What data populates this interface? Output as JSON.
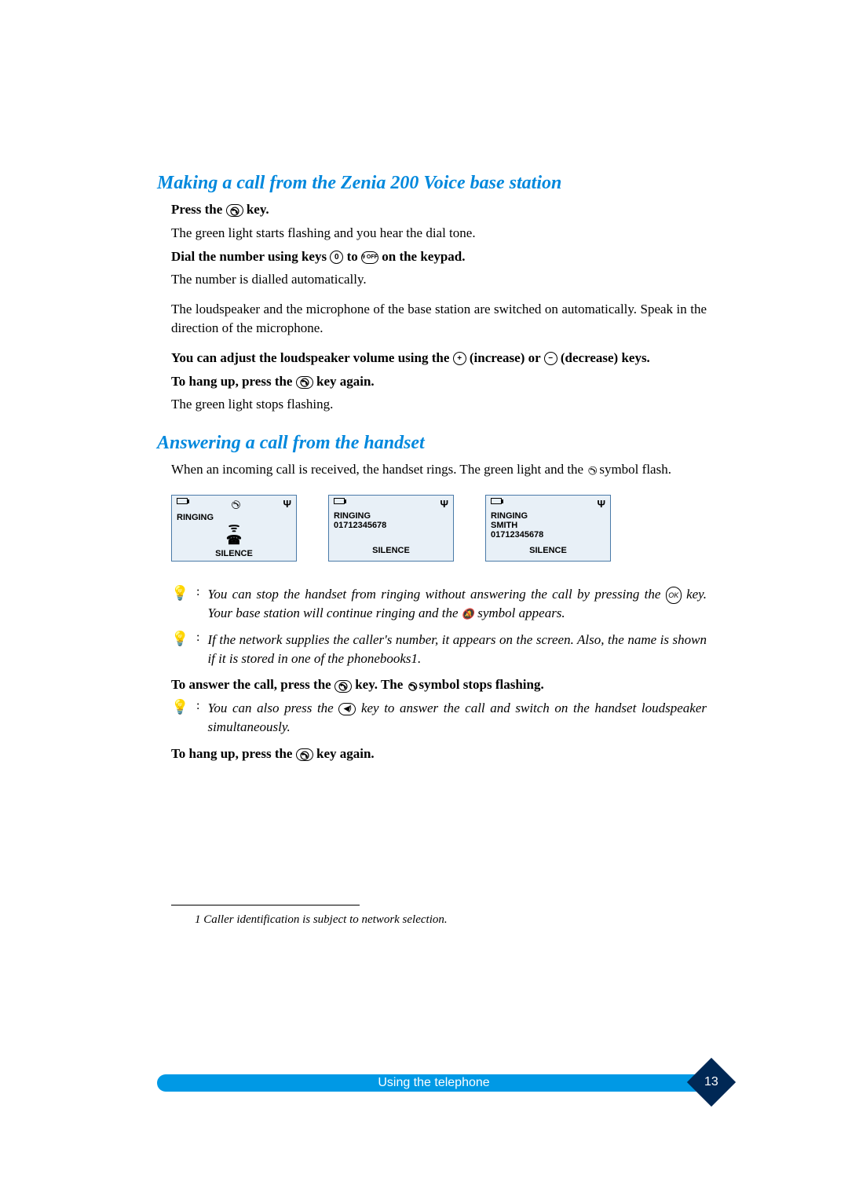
{
  "section1": {
    "heading": "Making a call from the Zenia 200 Voice base station",
    "press_the": "Press the ",
    "key_word": " key.",
    "green_flash": "The green light starts flashing and you hear the dial tone.",
    "dial_prefix": "Dial the number using keys ",
    "dial_to": " to ",
    "dial_suffix": " on the keypad.",
    "auto_dial": "The number is dialled automatically.",
    "loudspeaker": "The loudspeaker and the microphone of the base station are switched on automatically. Speak in the direction of the microphone.",
    "adjust_prefix": "You can adjust the loudspeaker volume using the ",
    "increase": " (increase) or ",
    "decrease": " (decrease) keys.",
    "hangup_prefix": "To hang up, press the ",
    "hangup_suffix": " key again.",
    "green_stop": "The green light stops flashing."
  },
  "section2": {
    "heading": "Answering a call from the handset",
    "intro_prefix": "When an incoming call is received, the handset rings. The green light and the ",
    "intro_suffix": " symbol flash.",
    "screens": [
      {
        "lines": [
          "RINGING"
        ],
        "footer": "SILENCE",
        "show_phone_center": true,
        "show_handset_top": true
      },
      {
        "lines": [
          "RINGING",
          "01712345678"
        ],
        "footer": "SILENCE",
        "show_phone_center": false,
        "show_handset_top": false
      },
      {
        "lines": [
          "RINGING",
          "SMITH",
          "01712345678"
        ],
        "footer": "SILENCE",
        "show_phone_center": false,
        "show_handset_top": false
      }
    ],
    "tip1_a": "You can stop the handset from ringing without answering the call by pressing the ",
    "tip1_b": " key. Your base station will continue ringing and the ",
    "tip1_c": " symbol appears.",
    "tip2": "If the network supplies the caller's number, it appears on the screen. Also, the name is shown if it is stored in one of the phonebooks1.",
    "answer_prefix": "To answer the call, press the ",
    "answer_mid": " key. The ",
    "answer_suffix": " symbol stops flashing.",
    "tip3_a": "You can also press the ",
    "tip3_b": " key to answer the call and switch on the handset loudspeaker simultaneously.",
    "hangup2_prefix": "To hang up, press the ",
    "hangup2_suffix": " key again."
  },
  "footnote": "1 Caller identification is subject to network selection.",
  "footer": "Using the telephone",
  "page_number": "13",
  "keys": {
    "zero": "0",
    "nine_off": "9 OFF",
    "plus": "+",
    "minus": "−",
    "ok": "OK",
    "speaker": "🔊"
  }
}
